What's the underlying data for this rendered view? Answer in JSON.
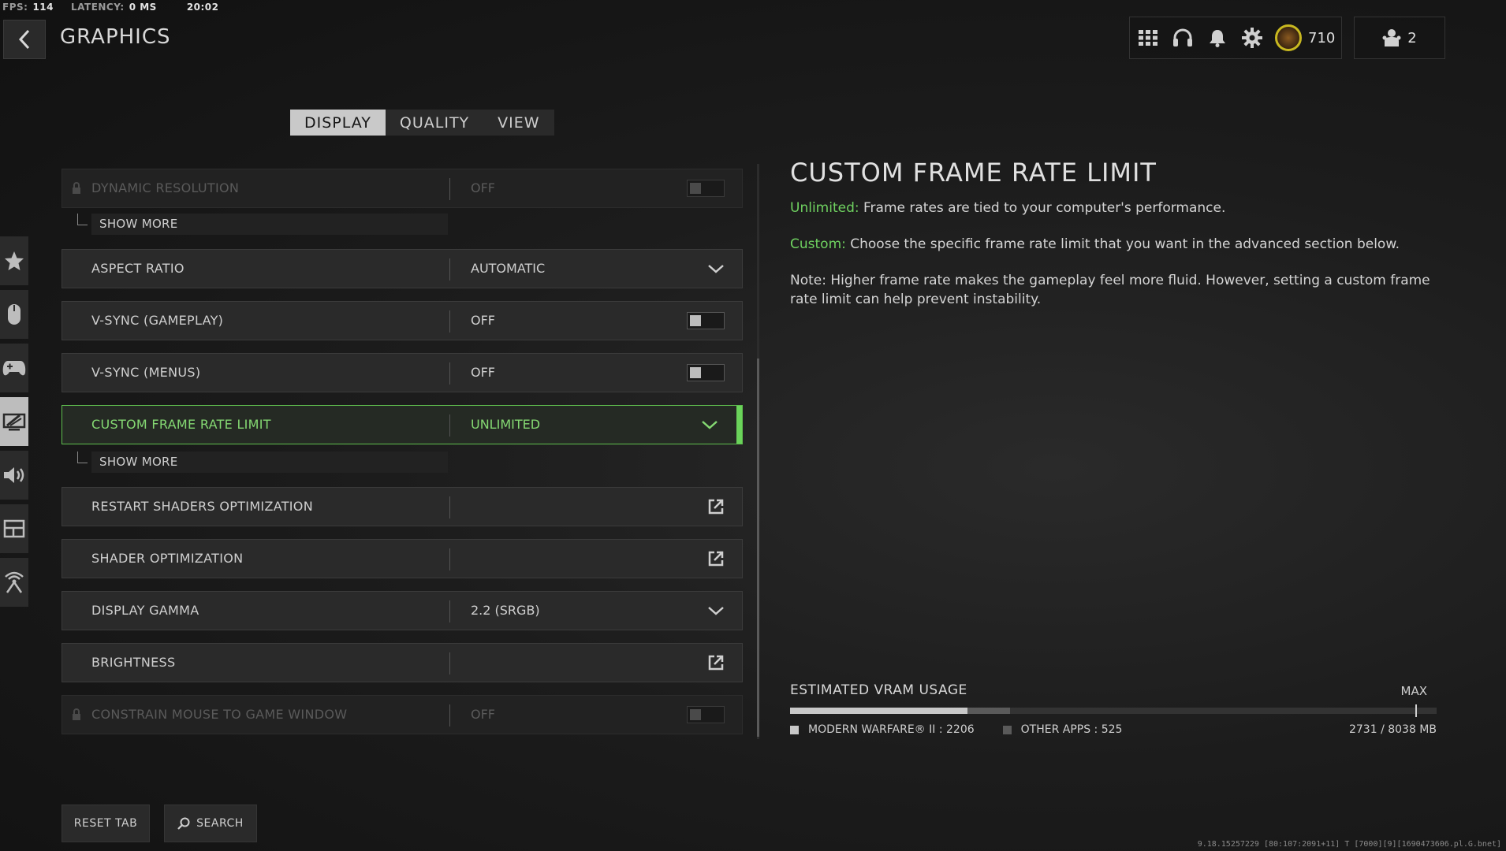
{
  "stats": {
    "fps_label": "FPS:",
    "fps_value": "114",
    "latency_label": "LATENCY:",
    "latency_value": "0 MS",
    "clock": "20:02"
  },
  "header": {
    "title": "GRAPHICS"
  },
  "topbar": {
    "cp_amount": "710",
    "party_count": "2"
  },
  "tabs": [
    {
      "label": "DISPLAY"
    },
    {
      "label": "QUALITY"
    },
    {
      "label": "VIEW"
    }
  ],
  "settings": {
    "dynamic_resolution": {
      "label": "DYNAMIC RESOLUTION",
      "value": "OFF"
    },
    "show_more": "SHOW MORE",
    "aspect_ratio": {
      "label": "ASPECT RATIO",
      "value": "AUTOMATIC"
    },
    "vsync_gameplay": {
      "label": "V-SYNC (GAMEPLAY)",
      "value": "OFF"
    },
    "vsync_menus": {
      "label": "V-SYNC (MENUS)",
      "value": "OFF"
    },
    "custom_frame_rate": {
      "label": "CUSTOM FRAME RATE LIMIT",
      "value": "UNLIMITED"
    },
    "restart_shaders": {
      "label": "RESTART SHADERS OPTIMIZATION"
    },
    "shader_optimization": {
      "label": "SHADER OPTIMIZATION"
    },
    "display_gamma": {
      "label": "DISPLAY GAMMA",
      "value": "2.2 (SRGB)"
    },
    "brightness": {
      "label": "BRIGHTNESS"
    },
    "constrain_mouse": {
      "label": "CONSTRAIN MOUSE TO GAME WINDOW",
      "value": "OFF"
    }
  },
  "description": {
    "title": "CUSTOM FRAME RATE LIMIT",
    "unlimited_key": "Unlimited:",
    "unlimited_text": " Frame rates are tied to your computer's performance.",
    "custom_key": "Custom:",
    "custom_text": " Choose the specific frame rate limit that you want in the advanced section below.",
    "note": "Note: Higher frame rate makes the gameplay feel more fluid. However, setting a custom frame rate limit can help prevent instability."
  },
  "vram": {
    "title": "ESTIMATED VRAM USAGE",
    "max_label": "MAX",
    "mw_label": "MODERN WARFARE® II : 2206",
    "other_label": "OTHER APPS : 525",
    "total": "2731 / 8038 MB",
    "mw_mb": 2206,
    "other_mb": 525,
    "capacity_mb": 8038,
    "max_fraction": 0.967
  },
  "footer": {
    "reset_tab": "RESET TAB",
    "search": "SEARCH"
  },
  "build_string": "9.18.15257229 [80:107:2091+11] T [7000][9][1690473606.pl.G.bnet]",
  "colors": {
    "accent_green": "#6fd260",
    "selected_bg": "#252a24"
  }
}
